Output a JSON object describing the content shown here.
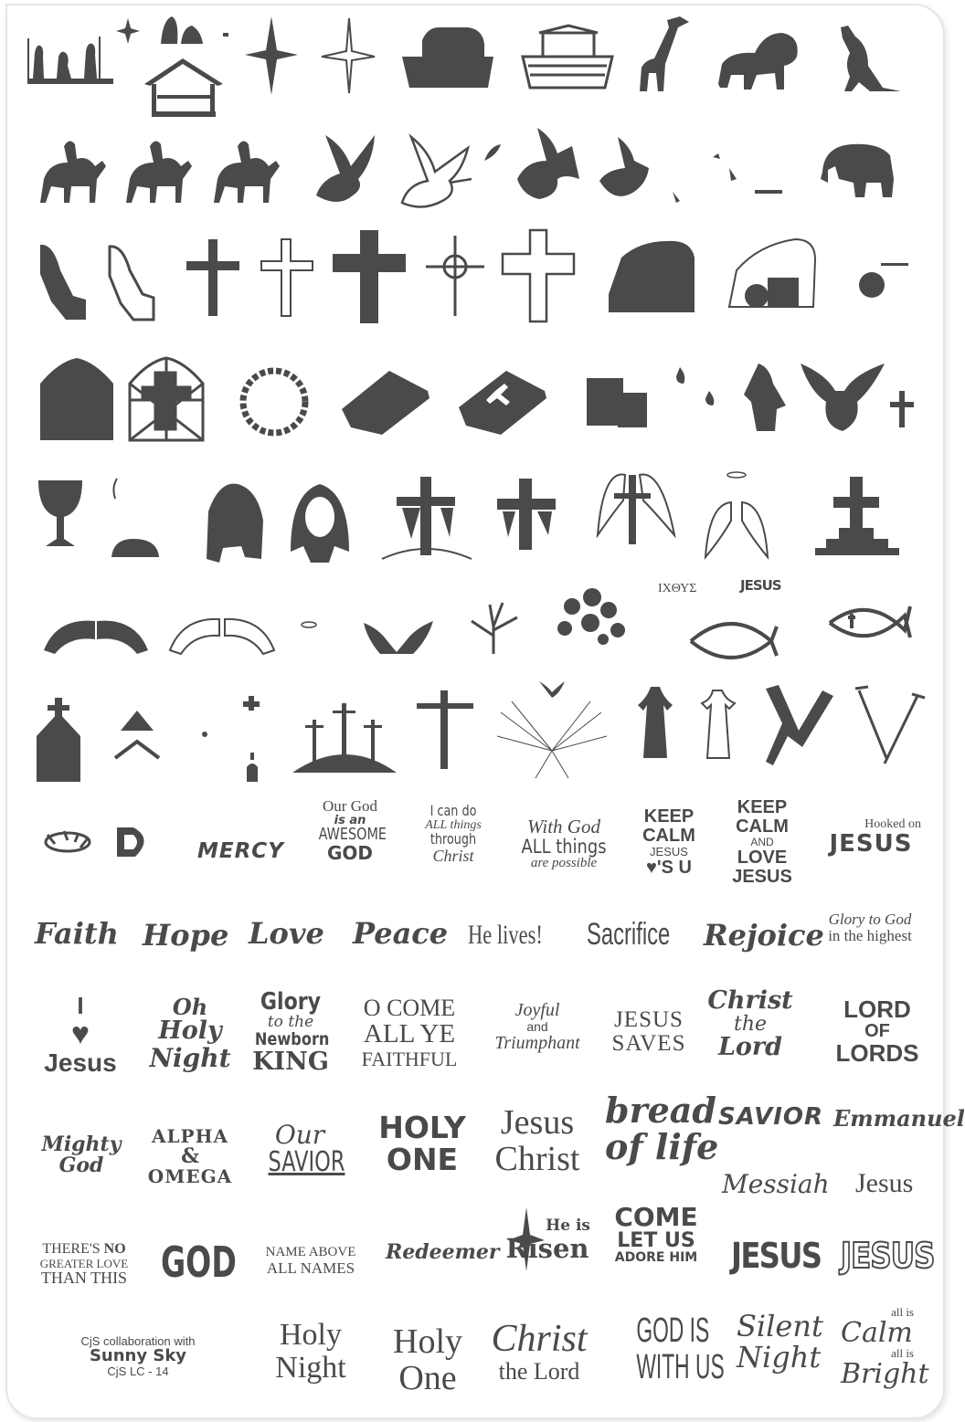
{
  "colors": {
    "ink": "#4a4a4a",
    "plate_border": "#e6e6e6",
    "background": "#ffffff"
  },
  "icons": {
    "row1": [
      "nativity-shepherds-icon",
      "star-small-icon",
      "mary-joseph-icon",
      "manger-stable-icon",
      "north-star-icon",
      "compass-star-icon",
      "noahs-ark-icon",
      "ark-outline-icon",
      "giraffe-icon",
      "lion-icon",
      "kangaroo-icon"
    ],
    "row2": [
      "camel-rider-1-icon",
      "camel-rider-2-icon",
      "camel-rider-3-icon",
      "dove-icon",
      "dove-olive-branch-icon",
      "olive-leaf-icon",
      "angel-flying-icon",
      "dove-small-icon",
      "elephant-icon"
    ],
    "row3": [
      "praying-hands-solid-icon",
      "praying-hands-outline-icon",
      "cross-plain-icon",
      "cross-outline-icon",
      "cross-ornate-icon",
      "cross-celtic-icon",
      "cross-outline-large-icon",
      "tomb-rock-icon",
      "tomb-open-icon",
      "tomb-stone-icon"
    ],
    "row4": [
      "arch-window-icon",
      "stained-glass-cross-icon",
      "crown-of-thorns-icon",
      "closed-book-icon",
      "holy-bible-icon",
      "candles-icon",
      "flames-icon",
      "angel-icon",
      "dove-descending-icon",
      "small-cross-icon"
    ],
    "row5": [
      "chalice-icon",
      "bread-loaf-icon",
      "jesus-silhouette-icon",
      "jesus-portrait-icon",
      "draped-cross-icon",
      "draped-cross-2-icon",
      "winged-cross-icon",
      "angel-wings-halo-icon",
      "cross-on-steps-icon"
    ],
    "row6": [
      "wings-solid-icon",
      "wings-outline-icon",
      "halo-icon",
      "open-hands-icon",
      "bare-tree-icon",
      "leafy-tree-icon",
      "ichthys-fish-icon",
      "ichthys-cross-fish-icon"
    ],
    "row7": [
      "church-icon",
      "chevron-up-icon",
      "small-dot-icon",
      "cross-tiny-icon",
      "three-crosses-calvary-icon",
      "crucifix-icon",
      "dove-rays-icon",
      "risen-christ-icon",
      "risen-christ-2-icon",
      "nails-icon",
      "nails-outline-icon"
    ],
    "row8": [
      "crown-of-thorns-small-icon",
      "thorn-crown-d-icon"
    ]
  },
  "text": {
    "ichthys_greek": "ΙΧΘΥΣ",
    "jesus_small": "JESUS",
    "mercy": "MERCY",
    "our_god": {
      "l1": "Our God",
      "l2": "is an",
      "l3": "AWESOME",
      "l4": "GOD"
    },
    "i_can_do": {
      "l1": "I can do",
      "l2": "ALL things",
      "l3": "through",
      "l4": "Christ"
    },
    "with_god": {
      "l1": "With God",
      "l2": "ALL things",
      "l3": "are possible"
    },
    "keep_calm_1": {
      "l1": "KEEP",
      "l2": "CALM",
      "l3": "JESUS",
      "l4": "♥'S U"
    },
    "keep_calm_2": {
      "l1": "KEEP",
      "l2": "CALM",
      "l3": "AND",
      "l4": "LOVE",
      "l5": "JESUS"
    },
    "hooked": {
      "l1": "Hooked on",
      "l2": "JESUS"
    },
    "words_row": [
      "Faith",
      "Hope",
      "Love",
      "Peace",
      "He lives!",
      "Sacrifice",
      "Rejoice"
    ],
    "glory_highest": {
      "l1": "Glory to God",
      "l2": "in the highest"
    },
    "i_love_jesus": {
      "l1": "I",
      "l2": "♥",
      "l3": "Jesus"
    },
    "oh_holy_night": {
      "l1": "Oh",
      "l2": "Holy",
      "l3": "Night"
    },
    "glory_newborn": {
      "l1": "Glory",
      "l2": "to the",
      "l3": "Newborn",
      "l4": "KING"
    },
    "o_come": {
      "l1": "O COME",
      "l2": "ALL YE",
      "l3": "FAITHFUL"
    },
    "joyful": {
      "l1": "Joyful",
      "l2": "and",
      "l3": "Triumphant"
    },
    "jesus_saves": {
      "l1": "JESUS",
      "l2": "SAVES"
    },
    "christ_the_lord_1": {
      "l1": "Christ",
      "l2": "the",
      "l3": "Lord"
    },
    "lord_of_lords": {
      "l1": "LORD",
      "l2": "OF",
      "l3": "LORDS"
    },
    "mighty_god": {
      "l1": "Mighty",
      "l2": "God"
    },
    "alpha_omega": {
      "l1": "ALPHA",
      "l2": "&",
      "l3": "OMEGA"
    },
    "our_savior": {
      "l1": "Our",
      "l2": "SAVIOR"
    },
    "holy_one_bold": {
      "l1": "HOLY",
      "l2": "ONE"
    },
    "jesus_christ": {
      "l1": "Jesus",
      "l2": "Christ"
    },
    "bread_of_life": {
      "l1": "bread",
      "l2": "of life"
    },
    "savior": "SAVIOR",
    "emmanuel": "Emmanuel",
    "messiah": "Messiah",
    "jesus_plain": "Jesus",
    "no_greater_love": {
      "l1a": "THERE'S ",
      "l1b": "NO",
      "l2": "GREATER LOVE",
      "l3": "THAN THIS"
    },
    "god_bold": "GOD",
    "name_above": {
      "l1": "NAME ABOVE",
      "l2": "ALL NAMES"
    },
    "redeemer": "Redeemer",
    "he_is_risen": {
      "l1": "He is",
      "l2": "Risen"
    },
    "come_let_us": {
      "l1": "COME",
      "l2": "LET US",
      "l3": "ADORE HIM"
    },
    "jesus_grunge": "JESUS",
    "jesus_outline": "JESUS",
    "credit": {
      "l1": "CjS collaboration with",
      "l2": "Sunny Sky",
      "l3": "CjS LC - 14"
    },
    "holy_night": {
      "l1": "Holy",
      "l2": "Night"
    },
    "holy_one": {
      "l1": "Holy",
      "l2": "One"
    },
    "christ_the_lord_2": {
      "l1": "Christ",
      "l2": "the Lord"
    },
    "god_is_with_us": {
      "l1": "GOD IS",
      "l2": "WITH US"
    },
    "silent_night": {
      "l1": "Silent",
      "l2": "Night"
    },
    "all_is_calm": {
      "l1": "all is",
      "l2": "Calm",
      "l3": "all is",
      "l4": "Bright"
    }
  }
}
